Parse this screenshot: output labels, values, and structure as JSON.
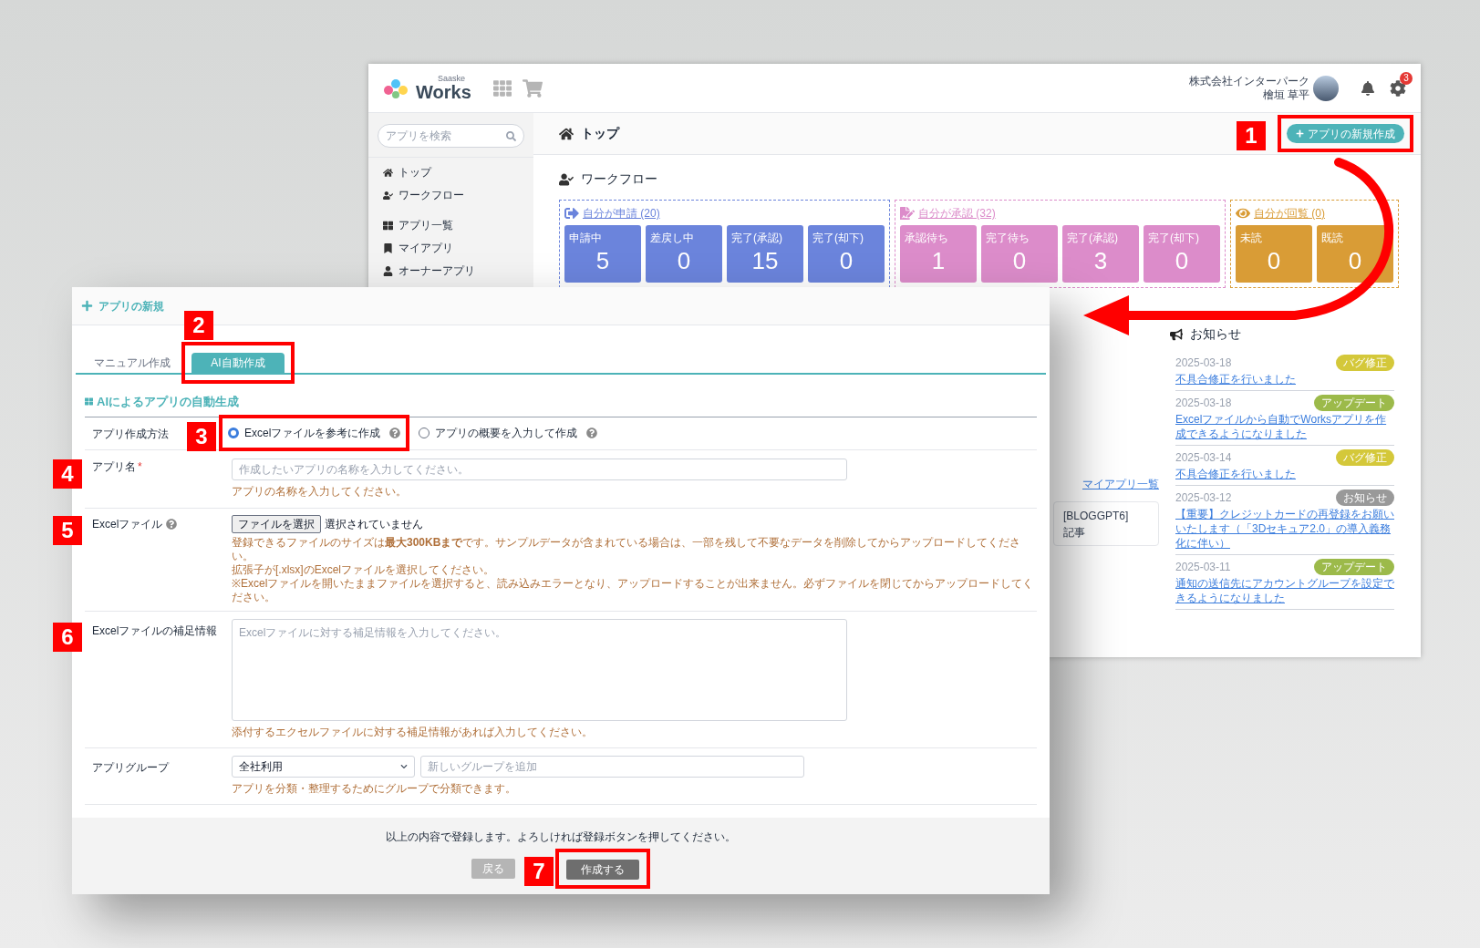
{
  "app_window": {
    "header": {
      "logo_tagline": "Saaske",
      "logo": "Works",
      "company": "株式会社インターパーク",
      "user": "檜垣 草平",
      "settings_badge": "3"
    },
    "sidebar": {
      "search_placeholder": "アプリを検索",
      "groups": [
        [
          {
            "label": "トップ"
          },
          {
            "label": "ワークフロー"
          }
        ],
        [
          {
            "label": "アプリ一覧"
          },
          {
            "label": "マイアプリ"
          },
          {
            "label": "オーナーアプリ"
          }
        ]
      ]
    },
    "page_title": "トップ",
    "new_app_button": "アプリの新規作成",
    "workflow": {
      "title": "ワークフロー",
      "groups": [
        {
          "title": "自分が申請 (20)",
          "color": "#6b84dc",
          "cards": [
            {
              "label": "申請中",
              "value": "5"
            },
            {
              "label": "差戻し中",
              "value": "0"
            },
            {
              "label": "完了(承認)",
              "value": "15"
            },
            {
              "label": "完了(却下)",
              "value": "0"
            }
          ]
        },
        {
          "title": "自分が承認 (32)",
          "color": "#dc8cca",
          "cards": [
            {
              "label": "承認待ち",
              "value": "1"
            },
            {
              "label": "完了待ち",
              "value": "0"
            },
            {
              "label": "完了(承認)",
              "value": "3"
            },
            {
              "label": "完了(却下)",
              "value": "0"
            }
          ]
        },
        {
          "title": "自分が回覧 (0)",
          "color": "#d99c36",
          "cards": [
            {
              "label": "未読",
              "value": "0"
            },
            {
              "label": "既読",
              "value": "0"
            }
          ]
        }
      ]
    },
    "my_apps_link": "マイアプリ一覧",
    "app_card": {
      "name": "[BLOGGPT6]",
      "category": "記事"
    },
    "notices": {
      "title": "お知らせ",
      "items": [
        {
          "date": "2025-03-18",
          "tag": "バグ修正",
          "color": "#d4c83a",
          "text": "不具合修正を行いました"
        },
        {
          "date": "2025-03-18",
          "tag": "アップデート",
          "color": "#9cba4a",
          "text": "Excelファイルから自動でWorksアプリを作成できるようになりました"
        },
        {
          "date": "2025-03-14",
          "tag": "バグ修正",
          "color": "#d4c83a",
          "text": "不具合修正を行いました"
        },
        {
          "date": "2025-03-12",
          "tag": "お知らせ",
          "color": "#999999",
          "text": "【重要】クレジットカードの再登録をお願いいたします（「3Dセキュア2.0」の導入義務化に伴い）"
        },
        {
          "date": "2025-03-11",
          "tag": "アップデート",
          "color": "#9cba4a",
          "text": "通知の送信先にアカウントグループを設定できるようになりました"
        }
      ]
    }
  },
  "modal": {
    "title": "アプリの新規",
    "tabs": [
      {
        "label": "マニュアル作成",
        "selected": false
      },
      {
        "label": "AI自動作成",
        "selected": true
      }
    ],
    "section_title": "AIによるアプリの自動生成",
    "method": {
      "label": "アプリ作成方法",
      "options": [
        {
          "label": "Excelファイルを参考に作成",
          "selected": true
        },
        {
          "label": "アプリの概要を入力して作成",
          "selected": false
        }
      ]
    },
    "app_name": {
      "label": "アプリ名",
      "required_mark": "*",
      "placeholder": "作成したいアプリの名称を入力してください。",
      "help": "アプリの名称を入力してください。"
    },
    "excel_file": {
      "label": "Excelファイル",
      "button": "ファイルを選択",
      "status": "選択されていません",
      "notes": [
        "登録できるファイルのサイズは**最大300KBまで**です。サンプルデータが含まれている場合は、一部を残して不要なデータを削除してからアップロードしてください。",
        "拡張子が[.xlsx]のExcelファイルを選択してください。",
        "※Excelファイルを開いたままファイルを選択すると、読み込みエラーとなり、アップロードすることが出来ません。必ずファイルを閉じてからアップロードしてください。"
      ]
    },
    "supplement": {
      "label": "Excelファイルの補足情報",
      "placeholder": "Excelファイルに対する補足情報を入力してください。",
      "help": "添付するエクセルファイルに対する補足情報があれば入力してください。"
    },
    "group": {
      "label": "アプリグループ",
      "value": "全社利用",
      "new_placeholder": "新しいグループを追加",
      "help": "アプリを分類・整理するためにグループで分類できます。"
    },
    "footer": {
      "message": "以上の内容で登録します。よろしければ登録ボタンを押してください。",
      "back": "戻る",
      "submit": "作成する"
    }
  },
  "annotations": [
    {
      "number": "1",
      "framed": true
    },
    {
      "number": "2",
      "framed": true
    },
    {
      "number": "3",
      "framed": true
    },
    {
      "number": "4",
      "framed": false
    },
    {
      "number": "5",
      "framed": false
    },
    {
      "number": "6",
      "framed": false
    },
    {
      "number": "7",
      "framed": true
    }
  ]
}
